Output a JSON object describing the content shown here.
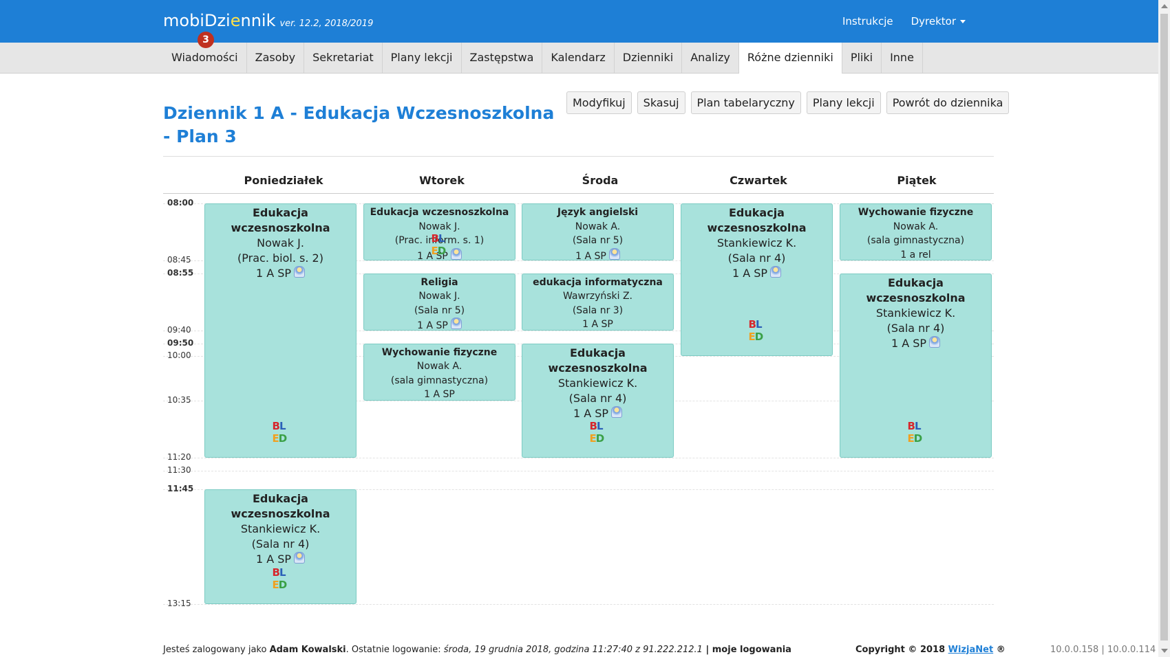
{
  "header": {
    "brand_pre": "mobiDzi",
    "brand_hl": "e",
    "brand_post": "nnik",
    "version": "ver. 12.2, 2018/2019",
    "badge": "3",
    "links": [
      "Instrukcje",
      "Dyrektor"
    ]
  },
  "menu": [
    "Wiadomości",
    "Zasoby",
    "Sekretariat",
    "Plany lekcji",
    "Zastępstwa",
    "Kalendarz",
    "Dzienniki",
    "Analizy",
    "Różne dzienniki",
    "Pliki",
    "Inne"
  ],
  "menu_active": "Różne dzienniki",
  "page_title": "Dziennik 1 A - Edukacja Wczesnoszkolna - Plan 3",
  "buttons": [
    "Modyfikuj",
    "Skasuj",
    "Plan tabelaryczny",
    "Plany lekcji",
    "Powrót do dziennika"
  ],
  "days": [
    "Poniedziałek",
    "Wtorek",
    "Środa",
    "Czwartek",
    "Piątek"
  ],
  "times": [
    "08:00",
    "08:45",
    "08:55",
    "09:40",
    "09:50",
    "10:00",
    "10:35",
    "11:20",
    "11:30",
    "11:45",
    "13:15"
  ],
  "lessons": [
    {
      "day": "Poniedziałek",
      "start": "08:00",
      "end": "11:20",
      "subject": "Edukacja wczesnoszkolna",
      "teacher": "Nowak J.",
      "room": "(Prac. biol. s. 2)",
      "group": "1 A SP",
      "people_icon": true,
      "logo": true
    },
    {
      "day": "Poniedziałek",
      "start": "11:45",
      "end": "13:15",
      "subject": "Edukacja wczesnoszkolna",
      "teacher": "Stankiewicz K.",
      "room": "(Sala nr 4)",
      "group": "1 A SP",
      "people_icon": true,
      "logo": true
    },
    {
      "day": "Wtorek",
      "start": "08:00",
      "end": "08:45",
      "subject": "Edukacja wczesnoszkolna",
      "teacher": "Nowak J.",
      "room": "(Prac. inform. s. 1)",
      "group": "1 A SP",
      "people_icon": true,
      "logo": true
    },
    {
      "day": "Wtorek",
      "start": "08:55",
      "end": "09:40",
      "subject": "Religia",
      "teacher": "Nowak J.",
      "room": "(Sala nr 5)",
      "group": "1 A SP",
      "people_icon": true,
      "logo": false
    },
    {
      "day": "Wtorek",
      "start": "09:50",
      "end": "10:35",
      "subject": "Wychowanie fizyczne",
      "teacher": "Nowak A.",
      "room": "(sala gimnastyczna)",
      "group": "1 A SP",
      "people_icon": false,
      "logo": false
    },
    {
      "day": "Środa",
      "start": "08:00",
      "end": "08:45",
      "subject": "Język angielski",
      "teacher": "Nowak A.",
      "room": "(Sala nr 5)",
      "group": "1 A SP",
      "people_icon": true,
      "logo": false
    },
    {
      "day": "Środa",
      "start": "08:55",
      "end": "09:40",
      "subject": "edukacja informatyczna",
      "teacher": "Wawrzyński Z.",
      "room": "(Sala nr 3)",
      "group": "1 A SP",
      "people_icon": false,
      "logo": false
    },
    {
      "day": "Środa",
      "start": "09:50",
      "end": "11:20",
      "subject": "Edukacja wczesnoszkolna",
      "teacher": "Stankiewicz K.",
      "room": "(Sala nr 4)",
      "group": "1 A SP",
      "people_icon": true,
      "logo": true
    },
    {
      "day": "Czwartek",
      "start": "08:00",
      "end": "10:00",
      "subject": "Edukacja wczesnoszkolna",
      "teacher": "Stankiewicz K.",
      "room": "(Sala nr 4)",
      "group": "1 A SP",
      "people_icon": true,
      "logo": true
    },
    {
      "day": "Piątek",
      "start": "08:00",
      "end": "08:45",
      "subject": "Wychowanie fizyczne",
      "teacher": "Nowak A.",
      "room": "(sala gimnastyczna)",
      "group": "1 a rel",
      "people_icon": false,
      "logo": false
    },
    {
      "day": "Piątek",
      "start": "08:55",
      "end": "11:20",
      "subject": "Edukacja wczesnoszkolna",
      "teacher": "Stankiewicz K.",
      "room": "(Sala nr 4)",
      "group": "1 A SP",
      "people_icon": true,
      "logo": true
    }
  ],
  "logo_text": {
    "top": "BL",
    "bottom": "ED"
  },
  "footer": {
    "prefix": "Jesteś zalogowany jako ",
    "user": "Adam Kowalski",
    "middle": ". Ostatnie logowanie: ",
    "last_login": "środa, 19 grudnia 2018, godzina 11:27:40 z 91.222.212.1",
    "sep": " | ",
    "link": "moje logowania",
    "copyright_pre": "Copyright © 2018 ",
    "copyright_link": "WizjaNet",
    "copyright_post": " ®",
    "ips": "10.0.0.158 | 10.0.0.114"
  },
  "colors": {
    "brand_blue": "#1e7fd6",
    "card_bg": "#a8e2dc",
    "badge_red": "#c0301f"
  }
}
